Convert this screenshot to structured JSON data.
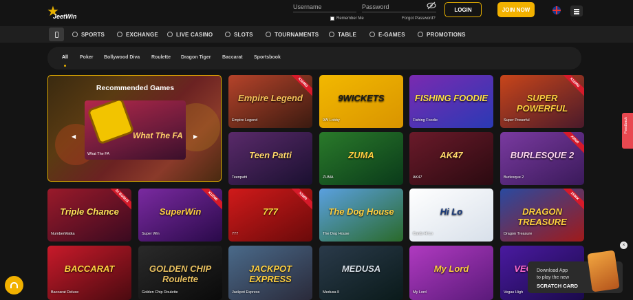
{
  "brand": {
    "logo_text": "JeetWin"
  },
  "login": {
    "username_placeholder": "Username",
    "password_placeholder": "Password",
    "remember_label": "Remember Me",
    "forgot_label": "Forgot Password?",
    "login_label": "LOGIN",
    "join_label": "JOIN NOW"
  },
  "nav": {
    "items": [
      {
        "label": "SPORTS",
        "icon": "soccer-ball-icon"
      },
      {
        "label": "EXCHANGE",
        "icon": "exchange-icon"
      },
      {
        "label": "LIVE CASINO",
        "icon": "dealer-icon"
      },
      {
        "label": "SLOTS",
        "icon": "slot-machine-icon"
      },
      {
        "label": "TOURNAMENTS",
        "icon": "trophy-icon"
      },
      {
        "label": "TABLE",
        "icon": "table-icon"
      },
      {
        "label": "E-GAMES",
        "icon": "gamepad-icon"
      },
      {
        "label": "PROMOTIONS",
        "icon": "gift-icon"
      }
    ]
  },
  "categories": [
    "All",
    "Poker",
    "Bollywood Diva",
    "Roulette",
    "Dragon Tiger",
    "Baccarat",
    "Sportsbook"
  ],
  "recommended": {
    "title": "Recommended Games",
    "game_label": "What The FA",
    "art_text": "What The FA"
  },
  "games": [
    {
      "label": "Empire Legend",
      "art": "Empire Legend",
      "badge": "X16000",
      "color": "#b5432a",
      "color2": "#3a1a10",
      "text": "#f7c35a"
    },
    {
      "label": "9W Lobby",
      "art": "9WICKETS",
      "badge": "",
      "color": "#f2b800",
      "color2": "#d99400",
      "text": "#1a1a1a"
    },
    {
      "label": "Fishing Foodie",
      "art": "FISHING FOODIE",
      "badge": "",
      "color": "#7a2ab0",
      "color2": "#2a3ab5",
      "text": "#ffe04a"
    },
    {
      "label": "Super Powerful",
      "art": "SUPER POWERFUL",
      "badge": "X12000",
      "color": "#c8451a",
      "color2": "#4a1a2a",
      "text": "#ffd040"
    },
    {
      "label": "Teenpatti",
      "art": "Teen Patti",
      "badge": "",
      "color": "#5a2a6a",
      "color2": "#1a1030",
      "text": "#ffd76a"
    },
    {
      "label": "ZUMA",
      "art": "ZUMA",
      "badge": "",
      "color": "#2a7a2a",
      "color2": "#0a3a1a",
      "text": "#ffd040"
    },
    {
      "label": "AK47",
      "art": "AK47",
      "badge": "",
      "color": "#6a1a2a",
      "color2": "#2a0a10",
      "text": "#ffd76a"
    },
    {
      "label": "Burlesque 2",
      "art": "BURLESQUE 2",
      "badge": "X3000",
      "color": "#7a3aa0",
      "color2": "#3a1a5a",
      "text": "#ffd6f0"
    },
    {
      "label": "NumberMatka",
      "art": "Triple Chance",
      "badge": "2x BONUS",
      "color": "#9a1a2a",
      "color2": "#3a0a20",
      "text": "#ffe35a"
    },
    {
      "label": "Super Win",
      "art": "SuperWin",
      "badge": "X12000",
      "color": "#7a2aa0",
      "color2": "#2a0a4a",
      "text": "#ffd040"
    },
    {
      "label": "777",
      "art": "777",
      "badge": "X1000",
      "color": "#d01a1a",
      "color2": "#6a0a0a",
      "text": "#ffe040"
    },
    {
      "label": "The Dog House",
      "art": "The Dog House",
      "badge": "",
      "color": "#5aa0e0",
      "color2": "#2a6a2a",
      "text": "#ffd040"
    },
    {
      "label": "Cards Hi Lo",
      "art": "Hi Lo",
      "badge": "",
      "color": "#ffffff",
      "color2": "#d8e0ea",
      "text": "#1a3a7a"
    },
    {
      "label": "Dragon Treasure",
      "art": "DRAGON TREASURE",
      "badge": "1500X",
      "color": "#2a4aa0",
      "color2": "#a01a1a",
      "text": "#ffd040"
    },
    {
      "label": "Baccarat Deluxe",
      "art": "BACCARAT",
      "badge": "",
      "color": "#c81a2a",
      "color2": "#4a0a10",
      "text": "#ffd040"
    },
    {
      "label": "Golden Chip Roulette",
      "art": "GOLDEN CHIP Roulette",
      "badge": "",
      "color": "#2a2a2a",
      "color2": "#0a0a0a",
      "text": "#e8c060"
    },
    {
      "label": "Jackpot Express",
      "art": "JACKPOT EXPRESS",
      "badge": "",
      "color": "#4a6a8a",
      "color2": "#2a2a3a",
      "text": "#ffd040"
    },
    {
      "label": "Medusa II",
      "art": "MEDUSA",
      "badge": "",
      "color": "#2a3a4a",
      "color2": "#0a1a1a",
      "text": "#d8e0e8"
    },
    {
      "label": "My Lord",
      "art": "My Lord",
      "badge": "",
      "color": "#b03ac0",
      "color2": "#5a1a7a",
      "text": "#ffd040"
    },
    {
      "label": "Vegas High",
      "art": "VEGAS HIGH",
      "badge": "",
      "color": "#4a1aa0",
      "color2": "#1a0a4a",
      "text": "#ff6ad0"
    }
  ],
  "feedback": {
    "label": "Feedback"
  },
  "promo": {
    "line1": "Download App",
    "line2": "to play the new",
    "line3": "SCRATCH CARD",
    "close": "×"
  },
  "colors": {
    "accent": "#f2b100",
    "background": "#141414",
    "nav": "#1f1f1f",
    "feedback": "#e84850"
  }
}
